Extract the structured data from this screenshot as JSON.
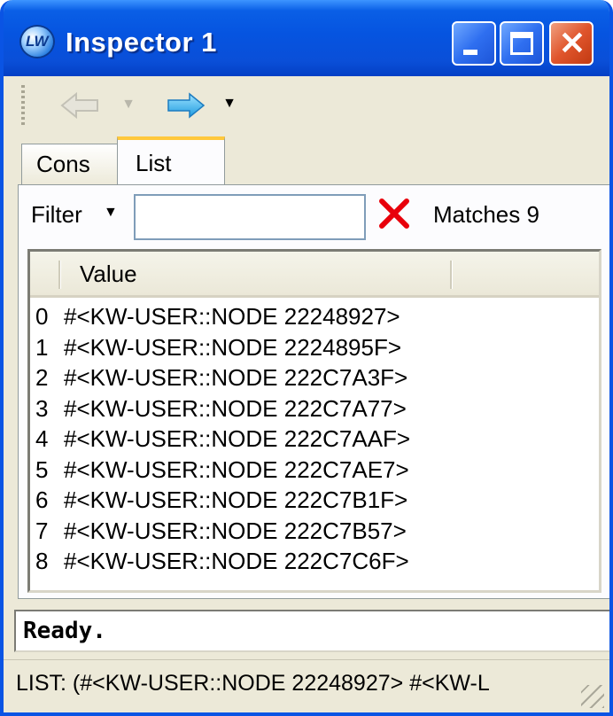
{
  "window": {
    "title": "Inspector 1",
    "app_icon_text": "LW",
    "accent_color": "#0A54E4",
    "close_color": "#E0552C"
  },
  "toolbar": {
    "back_icon": "arrow-left-icon",
    "forward_icon": "arrow-right-icon",
    "dropdown_glyph": "▼"
  },
  "tabs": [
    {
      "label": "Cons",
      "selected": false
    },
    {
      "label": "List",
      "selected": true
    }
  ],
  "filter": {
    "label": "Filter",
    "value": "",
    "placeholder": "",
    "clear_icon": "close-icon",
    "matches_text": "Matches 9"
  },
  "list": {
    "columns": [
      "Value"
    ],
    "rows": [
      {
        "index": "0",
        "value": "#<KW-USER::NODE 22248927>"
      },
      {
        "index": "1",
        "value": "#<KW-USER::NODE 2224895F>"
      },
      {
        "index": "2",
        "value": "#<KW-USER::NODE 222C7A3F>"
      },
      {
        "index": "3",
        "value": "#<KW-USER::NODE 222C7A77>"
      },
      {
        "index": "4",
        "value": "#<KW-USER::NODE 222C7AAF>"
      },
      {
        "index": "5",
        "value": "#<KW-USER::NODE 222C7AE7>"
      },
      {
        "index": "6",
        "value": "#<KW-USER::NODE 222C7B1F>"
      },
      {
        "index": "7",
        "value": "#<KW-USER::NODE 222C7B57>"
      },
      {
        "index": "8",
        "value": "#<KW-USER::NODE 222C7C6F>"
      }
    ]
  },
  "repl": {
    "text": "Ready."
  },
  "status": {
    "text": "LIST: (#<KW-USER::NODE 22248927> #<KW-L"
  }
}
